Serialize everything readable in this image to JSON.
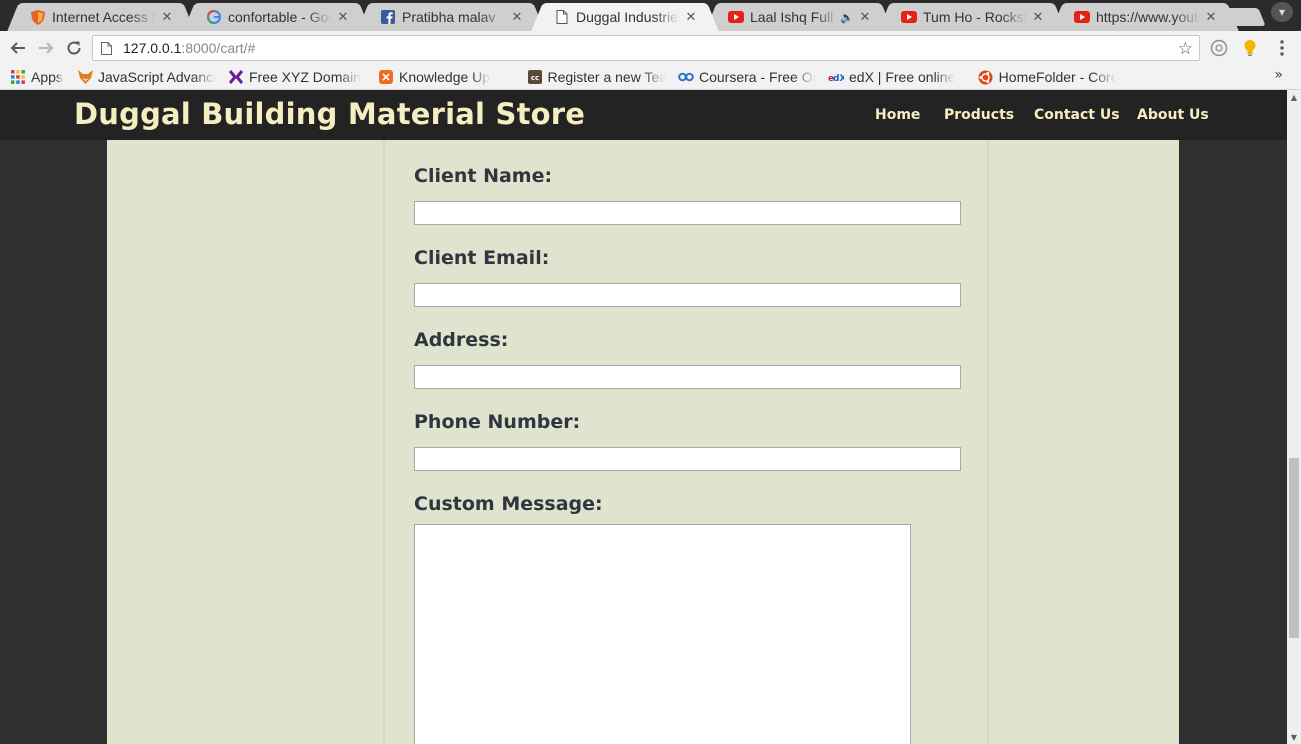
{
  "browser": {
    "tabs": [
      {
        "label": "Internet Access Denied",
        "icon": "shield-icon",
        "active": false
      },
      {
        "label": "confortable - Google Search",
        "icon": "google-icon",
        "active": false
      },
      {
        "label": "Pratibha malav",
        "icon": "facebook-icon",
        "active": false
      },
      {
        "label": "Duggal Industries",
        "icon": "page-icon",
        "active": true
      },
      {
        "label": "Laal Ishq Full Song",
        "icon": "youtube-icon",
        "active": false,
        "playing_audio": true
      },
      {
        "label": "Tum Ho - Rockstar",
        "icon": "youtube-icon",
        "active": false
      },
      {
        "label": "https://www.youtube.com",
        "icon": "youtube-icon",
        "active": false
      }
    ],
    "close_glyph": "✕",
    "address_bar": {
      "host": "127.0.0.1",
      "rest": ":8000/cart/#"
    },
    "bookmarks": [
      {
        "label": "Apps",
        "icon": "apps-grid-icon"
      },
      {
        "label": "JavaScript Advanced",
        "icon": "fox-icon"
      },
      {
        "label": "Free XYZ Domain",
        "icon": "xyz-icon"
      },
      {
        "label": "Knowledge Up",
        "icon": "knowledge-icon"
      },
      {
        "label": "Register a new Team",
        "icon": "cc-icon"
      },
      {
        "label": "Coursera - Free Online",
        "icon": "coursera-icon"
      },
      {
        "label": "edX | Free online",
        "icon": "edx-icon"
      },
      {
        "label": "HomeFolder - Core",
        "icon": "ubuntu-icon"
      }
    ],
    "bookmarks_overflow": "»"
  },
  "site": {
    "title": "Duggal Building Material Store",
    "nav": [
      {
        "label": "Home"
      },
      {
        "label": "Products"
      },
      {
        "label": "Contact Us"
      },
      {
        "label": "About Us"
      }
    ]
  },
  "form": {
    "client_name_label": "Client Name:",
    "client_name_value": "",
    "client_email_label": "Client Email:",
    "client_email_value": "",
    "address_label": "Address:",
    "address_value": "",
    "phone_label": "Phone Number:",
    "phone_value": "",
    "message_label": "Custom Message:",
    "message_value": ""
  },
  "colors": {
    "header_bg": "#232323",
    "title_color": "#f5eec0",
    "panel_bg": "#e0e3cd",
    "label_color": "#2f3640"
  }
}
